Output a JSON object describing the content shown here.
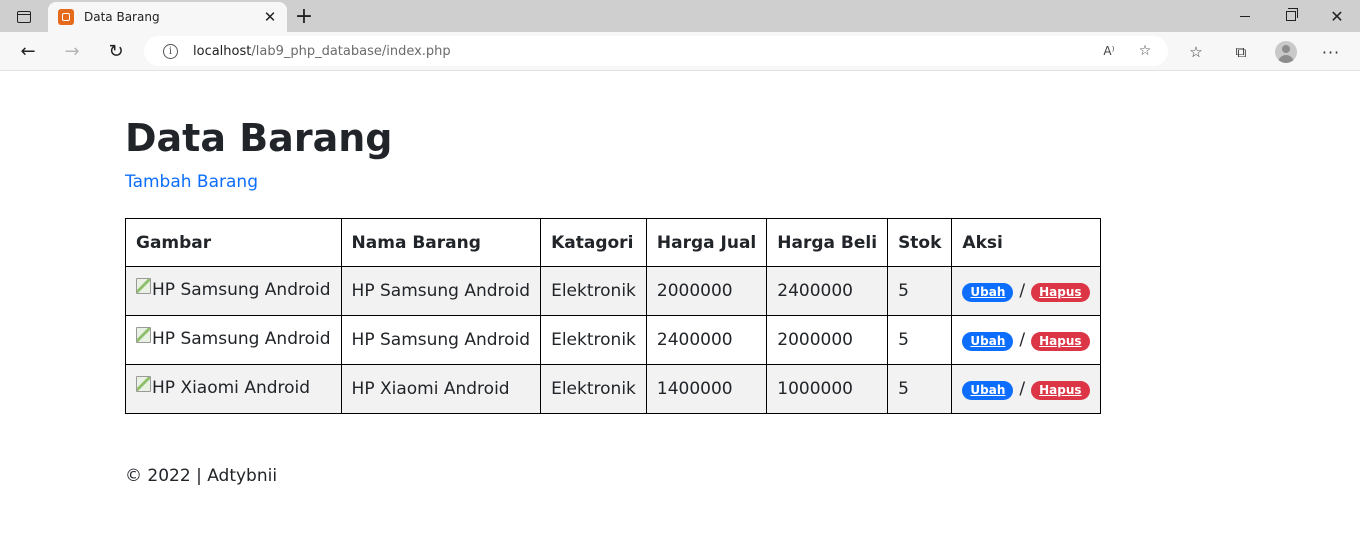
{
  "browser": {
    "tab_title": "Data Barang",
    "tab_close": "✕",
    "new_tab": "+",
    "url_host": "localhost",
    "url_path": "/lab9_php_database/index.php",
    "read_aloud": "A⁾",
    "win_close": "✕"
  },
  "page": {
    "title": "Data Barang",
    "add_link": "Tambah Barang",
    "table": {
      "headers": [
        "Gambar",
        "Nama Barang",
        "Katagori",
        "Harga Jual",
        "Harga Beli",
        "Stok",
        "Aksi"
      ],
      "rows": [
        {
          "gambar_alt": "HP Samsung Android",
          "nama": "HP Samsung Android",
          "kategori": "Elektronik",
          "harga_jual": "2000000",
          "harga_beli": "2400000",
          "stok": "5"
        },
        {
          "gambar_alt": "HP Samsung Android",
          "nama": "HP Samsung Android",
          "kategori": "Elektronik",
          "harga_jual": "2400000",
          "harga_beli": "2000000",
          "stok": "5"
        },
        {
          "gambar_alt": "HP Xiaomi Android",
          "nama": "HP Xiaomi Android",
          "kategori": "Elektronik",
          "harga_jual": "1400000",
          "harga_beli": "1000000",
          "stok": "5"
        }
      ],
      "action_edit": "Ubah",
      "action_separator": "/",
      "action_delete": "Hapus"
    },
    "footer": "© 2022 | Adtybnii"
  },
  "colors": {
    "link": "#0d6efd",
    "edit_badge": "#0d6efd",
    "delete_badge": "#dc3545",
    "favicon": "#e66a1c"
  },
  "icons": [
    "sidebar-icon",
    "xampp-favicon",
    "close-icon",
    "plus-icon",
    "back-arrow-icon",
    "forward-arrow-icon",
    "reload-icon",
    "info-icon",
    "read-aloud-icon",
    "add-favorite-icon",
    "favorites-icon",
    "collections-icon",
    "profile-icon",
    "more-icon"
  ]
}
